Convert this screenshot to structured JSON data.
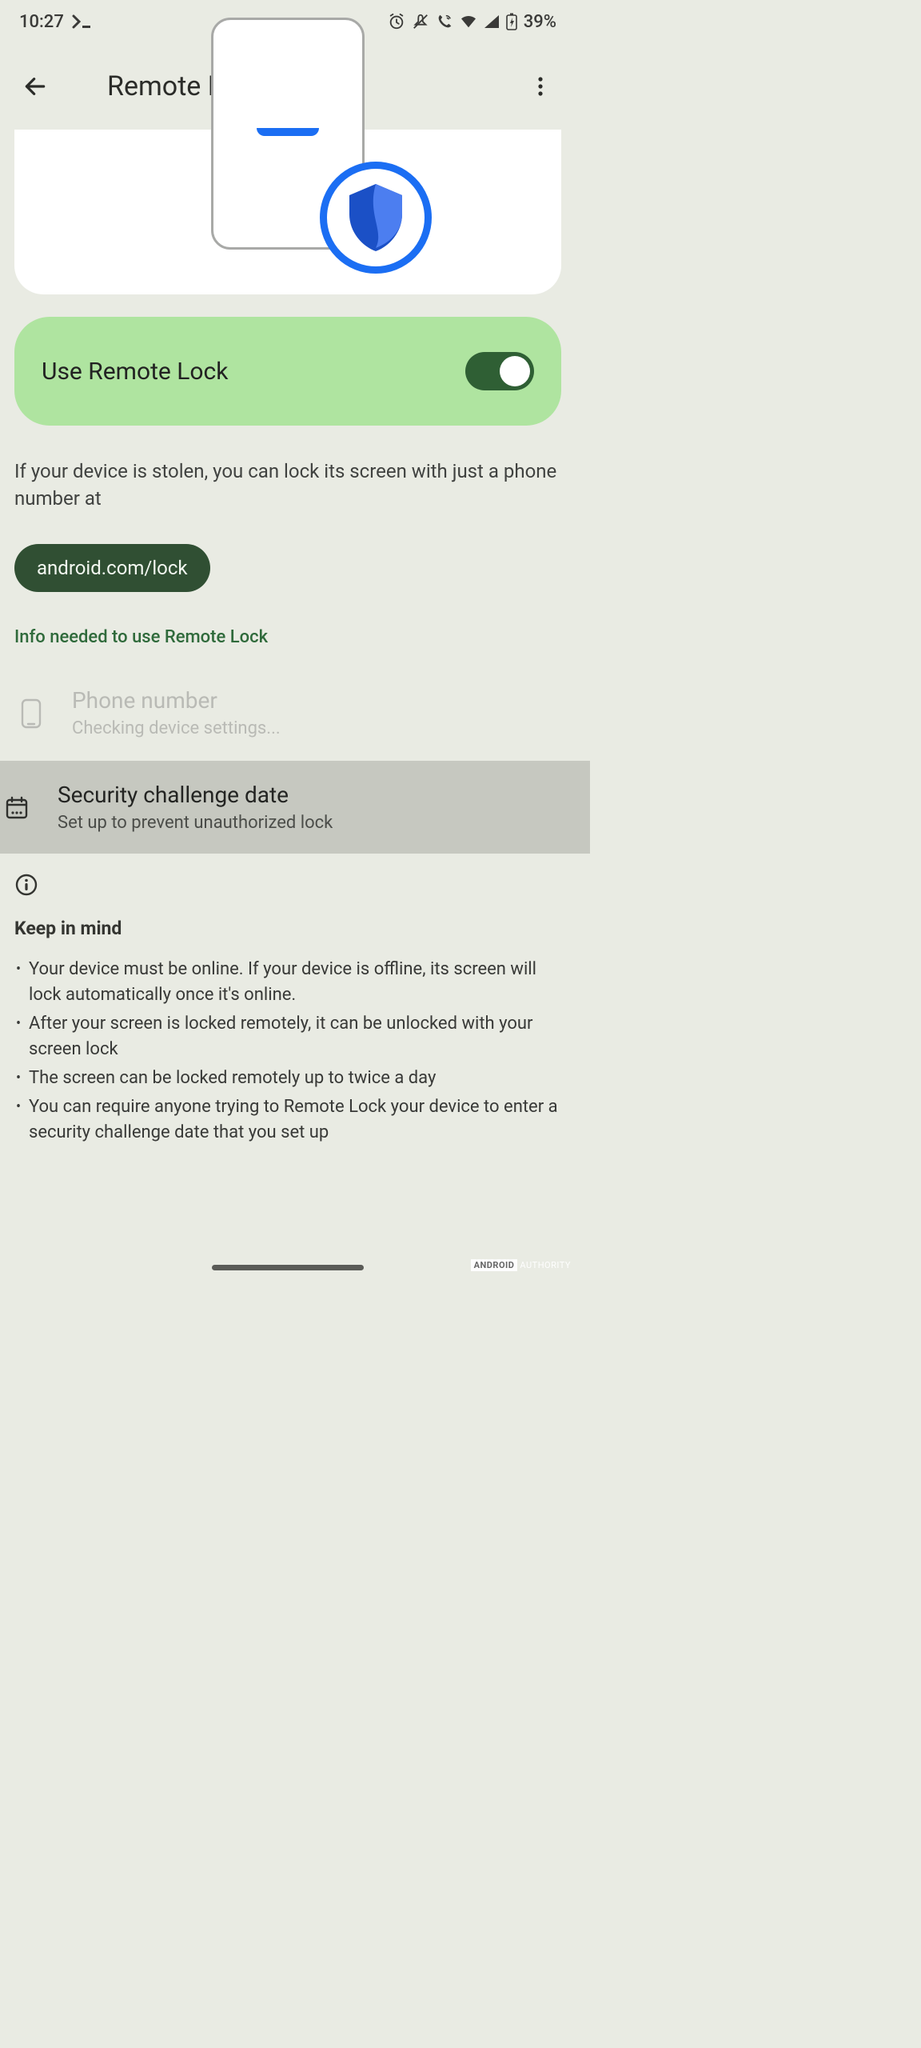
{
  "statusbar": {
    "time": "10:27",
    "battery_text": "39%"
  },
  "appbar": {
    "title": "Remote Lock"
  },
  "toggle": {
    "label": "Use Remote Lock",
    "on": true
  },
  "description": "If your device is stolen, you can lock its screen with just a phone number at",
  "link_chip": "android.com/lock",
  "section_header": "Info needed to use Remote Lock",
  "items": [
    {
      "title": "Phone number",
      "subtitle": "Checking device settings...",
      "icon": "phone-outline-icon",
      "disabled": true
    },
    {
      "title": "Security challenge date",
      "subtitle": "Set up to prevent unauthorized lock",
      "icon": "calendar-icon",
      "highlighted": true
    }
  ],
  "keep_in_mind": {
    "title": "Keep in mind",
    "bullets": [
      "Your device must be online. If your device is offline, its screen will lock automatically once it's online.",
      "After your screen is locked remotely, it can be unlocked with your screen lock",
      "The screen can be locked remotely up to twice a day",
      "You can require anyone trying to Remote Lock your device to enter a security challenge date that you set up"
    ]
  },
  "watermark": {
    "left": "ANDROID",
    "right": "AUTHORITY"
  }
}
